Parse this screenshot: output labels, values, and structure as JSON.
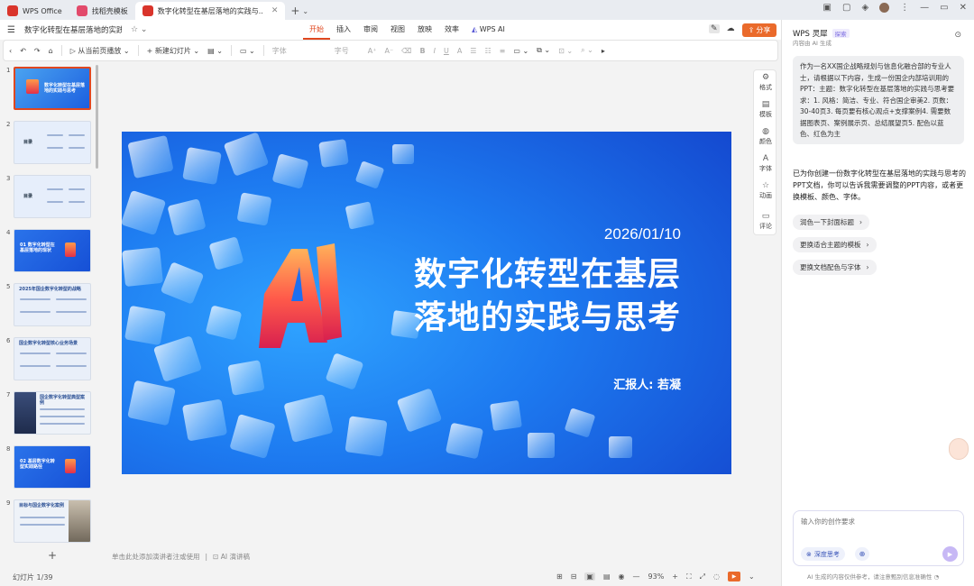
{
  "tabs": [
    {
      "label": "WPS Office",
      "color": "#d9342b"
    },
    {
      "label": "找稻壳模板",
      "color": "#e24a6b"
    },
    {
      "label": "数字化转型在基层落地的实践与..",
      "color": "#d9342b"
    }
  ],
  "doc": {
    "name": "数字化转型在基层落地的实践..."
  },
  "menu": [
    "开始",
    "插入",
    "审阅",
    "视图",
    "放映",
    "效率",
    "WPS AI"
  ],
  "share_label": "分享",
  "toolbar": {
    "play_from_current": "从当前页播放",
    "new_slide": "新建幻灯片",
    "font": "字体",
    "font_size": "字号"
  },
  "thumbnails": [
    {
      "num": "1",
      "title": "数字化转型在基层落地的实践与思考",
      "style": "cover"
    },
    {
      "num": "2",
      "title": "目录",
      "style": "light"
    },
    {
      "num": "3",
      "title": "目录",
      "style": "light"
    },
    {
      "num": "4",
      "title": "01 数字化转型在基层落地的现状",
      "style": "blue"
    },
    {
      "num": "5",
      "title": "2025年国企数字化转型的战略",
      "style": "light"
    },
    {
      "num": "6",
      "title": "国企数字化转型核心业务场景",
      "style": "light"
    },
    {
      "num": "7",
      "title": "国企数字化转型典型案例",
      "style": "dark"
    },
    {
      "num": "8",
      "title": "02 基层数字化转型实践路径",
      "style": "blue"
    },
    {
      "num": "9",
      "title": "目标与国企数字化案例",
      "style": "light"
    }
  ],
  "slide": {
    "date": "2026/01/10",
    "title_line1": "数字化转型在基层",
    "title_line2": "落地的实践与思考",
    "reporter": "汇报人: 若凝",
    "art_text": "AI"
  },
  "notes_placeholder": "单击此处添加演讲者注或使用",
  "notes_ai": "AI 演讲稿",
  "side_tools": [
    "格式",
    "模板",
    "颜色",
    "字体",
    "动画",
    "评论"
  ],
  "status": {
    "slide_counter": "幻灯片 1/39",
    "zoom": "93%"
  },
  "ai_panel": {
    "title": "WPS 灵犀",
    "badge": "探索",
    "subtitle": "内容由 AI 生成",
    "prompt": "作为一名XX国企战略规划与信息化融合部的专业人士，请根据以下内容，生成一份国企内部培训用的PPT：主题：数字化转型在基层落地的实践与思考要求：1. 风格：简洁、专业、符合国企审美2. 页数：30-40页3. 每页要有核心观点+支撑案例4. 需要数据图表页、案例展示页、总结展望页5. 配色以蓝色、红色为主",
    "reply": "已为你创建一份数字化转型在基层落地的实践与思考的PPT文档，你可以告诉我需要调整的PPT内容，或者更换模板、颜色、字体。",
    "suggestions": [
      "润色一下封面标题",
      "更换适合主题的模板",
      "更换文档配色与字体"
    ],
    "input_placeholder": "输入你的创作要求",
    "deep_think": "深度思考",
    "footer": "AI 生成的内容仅供参考，请注意甄别信息准确性"
  },
  "colors": {
    "accent": "#e0471f",
    "slide_bg": "#1a5fe0",
    "ai_purple": "#7a6ae0"
  }
}
